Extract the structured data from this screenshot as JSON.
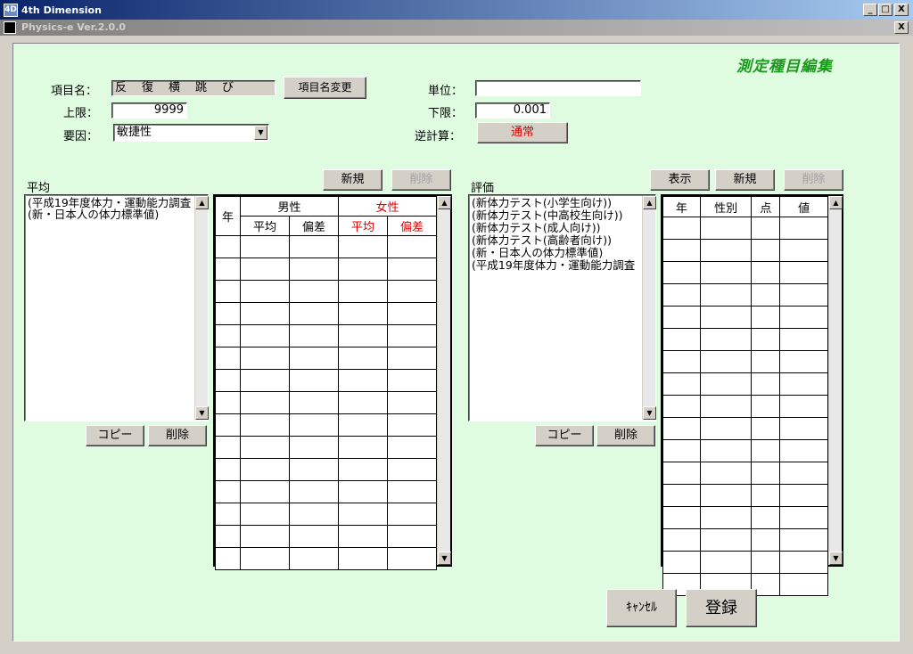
{
  "window": {
    "title": "4th Dimension",
    "subtitle": "Physics-e Ver.2.0.0",
    "minimize": "_",
    "maximize": "□",
    "close": "X"
  },
  "form": {
    "heading": "測定種目編集",
    "item_name_label": "項目名：",
    "item_name_value": "反　復　横　跳　び",
    "rename_button": "項目名変更",
    "unit_label": "単位：",
    "unit_value": "",
    "upper_label": "上限：",
    "upper_value": "9999",
    "lower_label": "下限：",
    "lower_value": "0.001",
    "factor_label": "要因：",
    "factor_value": "敏捷性",
    "reverse_label": "逆計算：",
    "reverse_button": "通常"
  },
  "average": {
    "label": "平均",
    "new_button": "新規",
    "delete_button": "削除",
    "list": [
      "(平成19年度体力・運動能力調査",
      "(新・日本人の体力標準値)"
    ],
    "copy_button": "コピー",
    "list_delete_button": "削除",
    "table": {
      "year": "年",
      "male": "男性",
      "female": "女性",
      "avg": "平均",
      "dev": "偏差"
    }
  },
  "evaluation": {
    "label": "評価",
    "show_button": "表示",
    "new_button": "新規",
    "delete_button": "削除",
    "list": [
      "(新体力テスト(小学生向け))",
      "(新体力テスト(中高校生向け))",
      "(新体力テスト(成人向け))",
      "(新体力テスト(高齢者向け))",
      "(新・日本人の体力標準値)",
      "(平成19年度体力・運動能力調査"
    ],
    "copy_button": "コピー",
    "list_delete_button": "削除",
    "table": {
      "year": "年",
      "sex": "性別",
      "points": "点",
      "value": "値"
    }
  },
  "footer": {
    "cancel_button": "ｷｬﾝｾﾙ",
    "register_button": "登録"
  },
  "colors": {
    "panel_bg": "#e0fce0",
    "heading": "#1a9a1a",
    "female_red": "#e00000"
  }
}
